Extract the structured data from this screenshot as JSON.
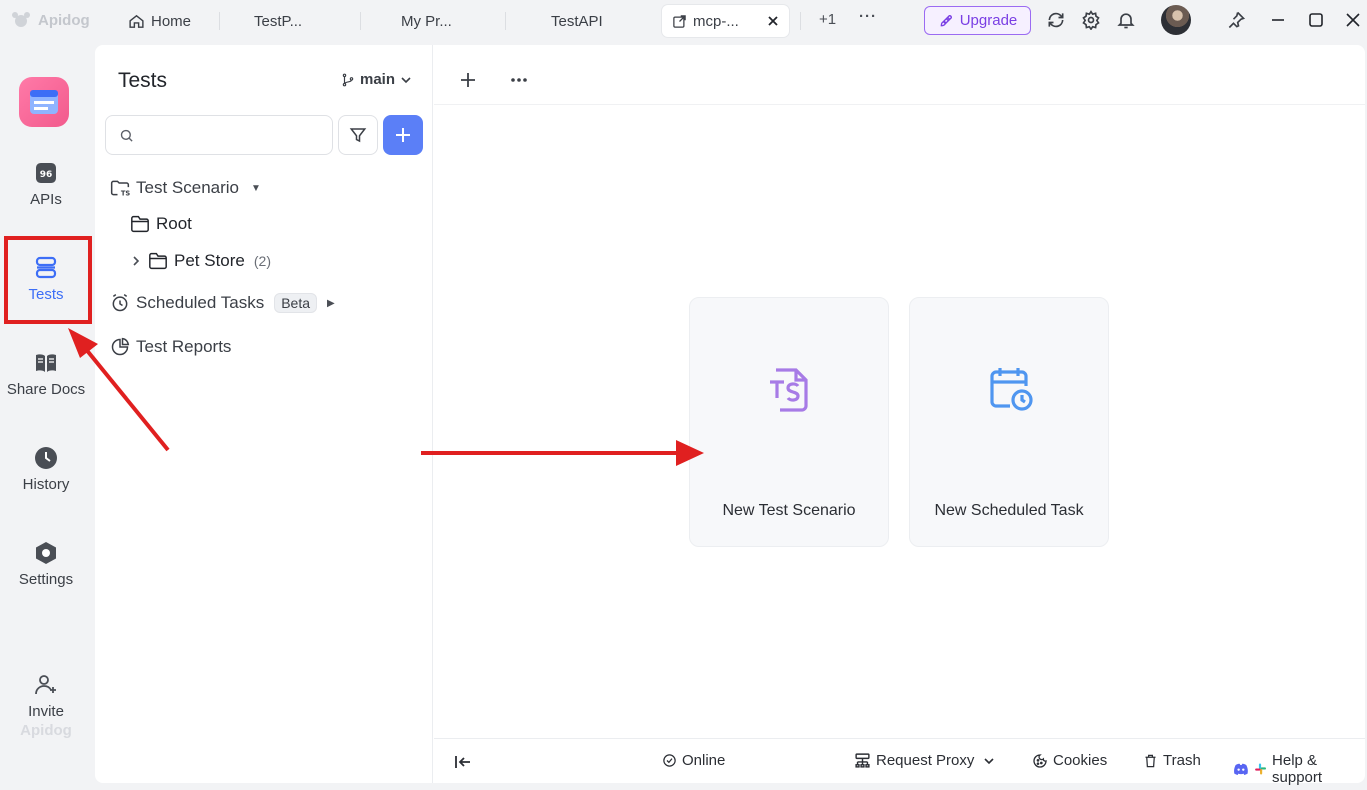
{
  "brand": {
    "name": "Apidog"
  },
  "tabs": [
    {
      "label": "Home",
      "icon": "home-icon"
    },
    {
      "label": "TestP..."
    },
    {
      "label": "My Pr..."
    },
    {
      "label": "TestAPI"
    },
    {
      "label": "mcp-...",
      "icon": "external-link-icon",
      "active": true
    }
  ],
  "top": {
    "more_tabs": "+1",
    "upgrade_label": "Upgrade"
  },
  "rail": {
    "items": [
      {
        "label": "APIs",
        "icon": "api-icon"
      },
      {
        "label": "Tests",
        "icon": "tests-icon",
        "active": true
      },
      {
        "label": "Share Docs",
        "icon": "book-icon"
      },
      {
        "label": "History",
        "icon": "clock-icon"
      },
      {
        "label": "Settings",
        "icon": "hexagon-icon"
      }
    ],
    "invite_label": "Invite",
    "watermark": "Apidog"
  },
  "sidebar": {
    "title": "Tests",
    "branch": "main",
    "search_placeholder": "",
    "tree": {
      "test_scenario": "Test Scenario",
      "root": "Root",
      "pet_store": "Pet Store",
      "pet_store_count": "(2)",
      "scheduled_tasks": "Scheduled Tasks",
      "beta": "Beta",
      "test_reports": "Test Reports"
    }
  },
  "cards": {
    "new_test_scenario": "New Test Scenario",
    "new_scheduled_task": "New Scheduled Task"
  },
  "footer": {
    "online": "Online",
    "request_proxy": "Request Proxy",
    "cookies": "Cookies",
    "trash": "Trash",
    "help": "Help & support"
  },
  "colors": {
    "accent": "#3d6ef6",
    "upgrade": "#7a3fe4",
    "annotation": "#e02020",
    "ts_icon": "#a77be6",
    "scheduled_icon": "#4f96f0"
  }
}
